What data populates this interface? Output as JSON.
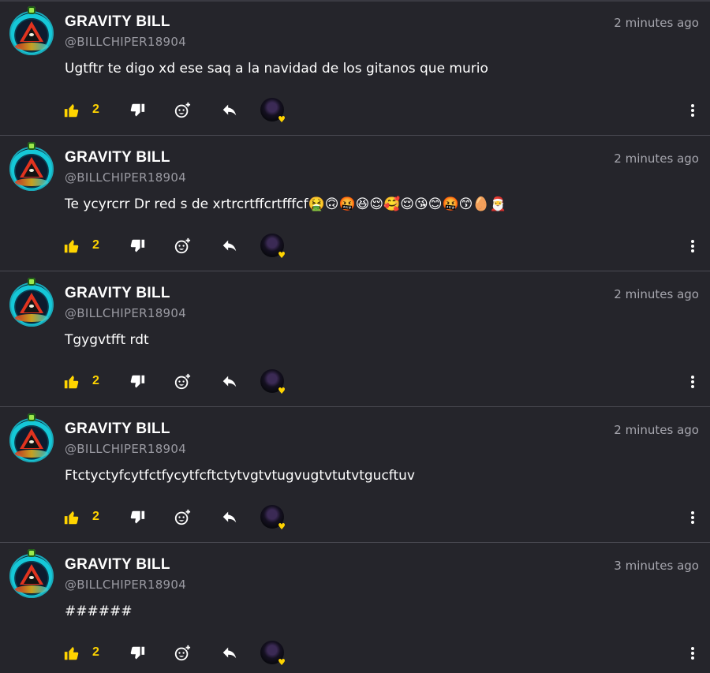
{
  "comments": [
    {
      "author": "GRAVITY BILL",
      "handle": "@BILLCHIPER18904",
      "time": "2 minutes ago",
      "text": "Ugtftr te digo xd ese saq a la navidad de los gitanos que murio",
      "likes": "2"
    },
    {
      "author": "GRAVITY BILL",
      "handle": "@BILLCHIPER18904",
      "time": "2 minutes ago",
      "text": "Te ycyrcrr Dr red s de xrtrcrtffcrtfffcf🤮🙃🤬😆😌🥰😌😘😊🤬😙🥚🎅",
      "likes": "2"
    },
    {
      "author": "GRAVITY BILL",
      "handle": "@BILLCHIPER18904",
      "time": "2 minutes ago",
      "text": "Tgygvtfft rdt",
      "likes": "2"
    },
    {
      "author": "GRAVITY BILL",
      "handle": "@BILLCHIPER18904",
      "time": "2 minutes ago",
      "text": "Ftctyctyfcytfctfycytfcftctytvgtvtugvugtvtutvtgucftuv",
      "likes": "2"
    },
    {
      "author": "GRAVITY BILL",
      "handle": "@BILLCHIPER18904",
      "time": "3 minutes ago",
      "text": "######",
      "likes": "2"
    }
  ],
  "colors": {
    "background": "#25252b",
    "accent": "#ffd400",
    "muted_text": "#9a9aa2",
    "divider": "#4a4a52"
  },
  "icons": {
    "like": "thumbs-up-icon",
    "dislike": "thumbs-down-icon",
    "react": "add-reaction-icon",
    "reply": "reply-arrow-icon",
    "more": "more-vertical-icon"
  }
}
